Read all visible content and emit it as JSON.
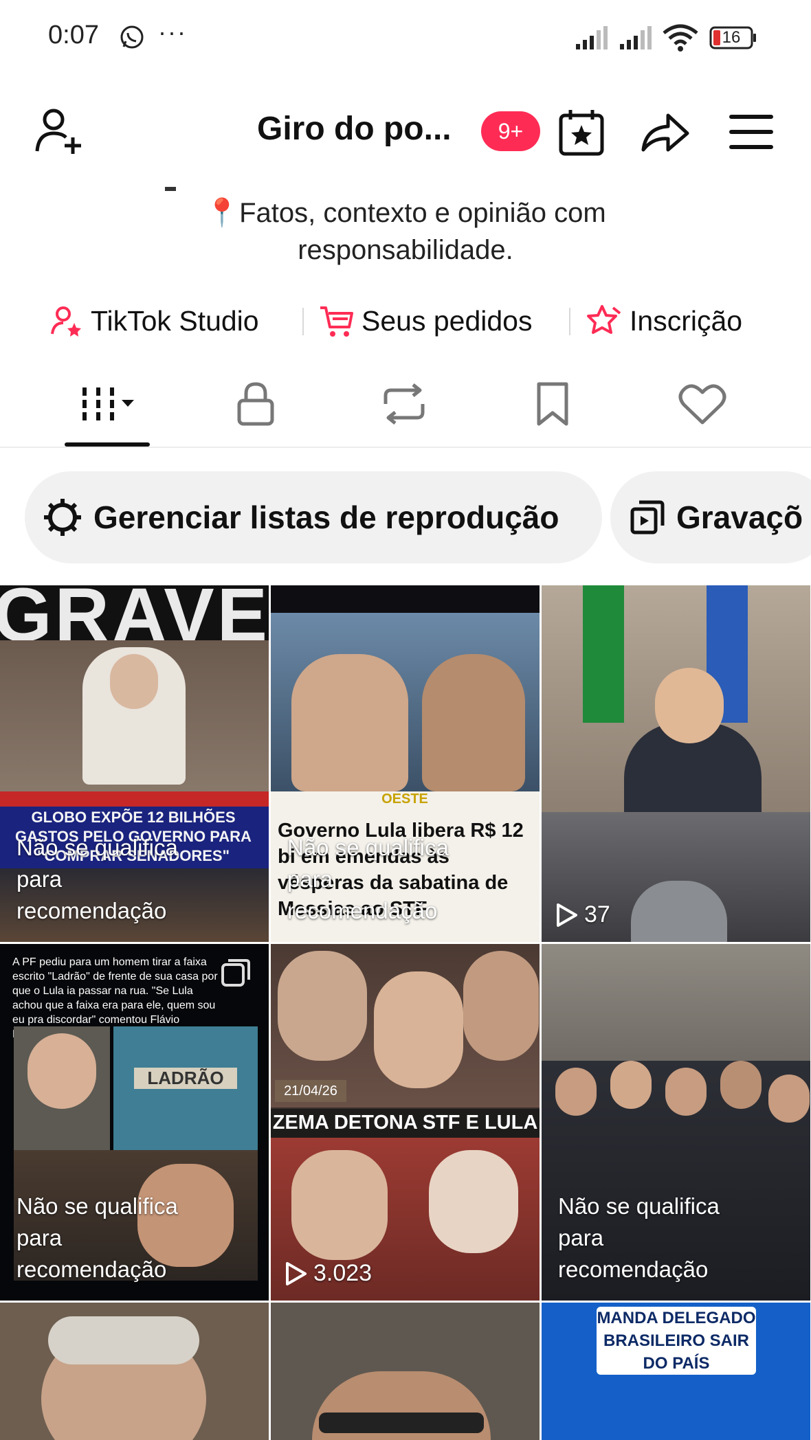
{
  "status_bar": {
    "time": "0:07",
    "more": "···",
    "battery": "16"
  },
  "header": {
    "title": "Giro do po...",
    "badge": "9+"
  },
  "bio": {
    "line1": "📍Fatos, contexto e opinião com",
    "line2": "responsabilidade."
  },
  "links": {
    "studio": "TikTok Studio",
    "orders": "Seus pedidos",
    "subscription": "Inscrição"
  },
  "chips": {
    "manage_playlists": "Gerenciar listas de reprodução",
    "recordings": "Gravaçõ"
  },
  "videos": [
    {
      "label": "Não se qualifica para recomendação",
      "banner": "GRAVE",
      "caption": "GLOBO EXPÕE 12 BILHÕES GASTOS PELO GOVERNO PARA \"COMPRAR SENADORES\""
    },
    {
      "label": "Não se qualifica para recomendação",
      "brand": "OESTE",
      "headline": "Governo Lula libera R$ 12 bi em emendas às vésperas da sabatina de Messias ao STF"
    },
    {
      "views": "37"
    },
    {
      "label": "Não se qualifica para recomendação",
      "story": "A PF pediu para um homem tirar a faixa escrito \"Ladrão\" de frente de sua casa por que o Lula ia passar na rua. \"Se Lula achou que a faixa era para ele, quem sou eu pra discordar\" comentou Flávio Bolsonaro.",
      "sign": "LADRÃO"
    },
    {
      "views": "3.023",
      "date": "21/04/26",
      "headline": "ZEMA DETONA STF E LULA"
    },
    {
      "label": "Não se qualifica para recomendação"
    },
    {},
    {},
    {
      "headline": "MANDA DELEGADO BRASILEIRO SAIR DO PAÍS"
    }
  ],
  "colors": {
    "accent": "#fe2c55",
    "chip_bg": "#f1f1f2",
    "text": "#161823"
  }
}
